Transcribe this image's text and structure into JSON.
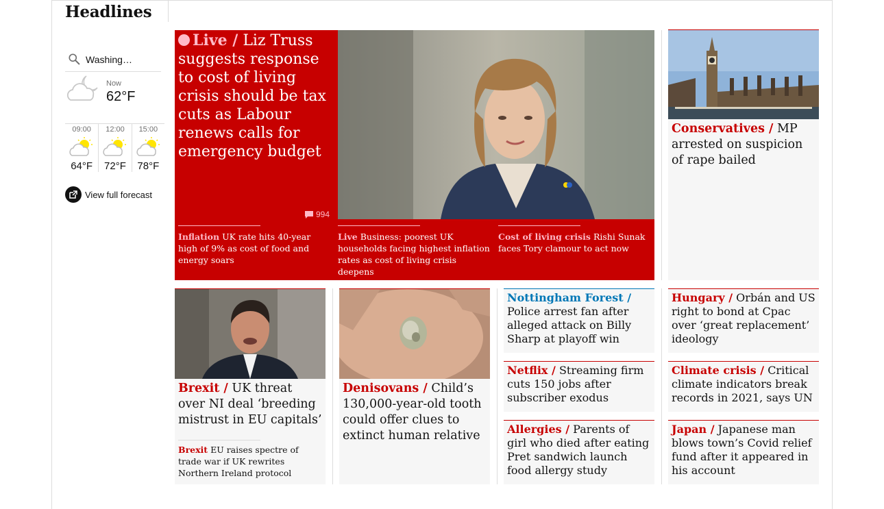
{
  "section_title": "Headlines",
  "weather": {
    "search_value": "Washing…",
    "now_label": "Now",
    "now_temp": "62°F",
    "forecast": [
      {
        "time": "09:00",
        "temp": "64°F",
        "icon": "partly-sunny-icon"
      },
      {
        "time": "12:00",
        "temp": "72°F",
        "icon": "partly-sunny-icon"
      },
      {
        "time": "15:00",
        "temp": "78°F",
        "icon": "partly-sunny-icon"
      }
    ],
    "full_forecast_label": "View full forecast"
  },
  "hero": {
    "kicker": "Live /",
    "headline": "Liz Truss suggests response to cost of living crisis should be tax cuts as Labour renews calls for emergency budget",
    "comments": "994",
    "sublinks": [
      {
        "kicker": "Inflation",
        "text": "UK rate hits 40-year high of 9% as cost of food and energy soars"
      },
      {
        "kicker": "Live",
        "text": "Business: poorest UK households facing highest inflation rates as cost of living crisis deepens"
      },
      {
        "kicker": "Cost of living crisis",
        "text": "Rishi Sunak faces Tory clamour to act now"
      }
    ]
  },
  "right_top": {
    "kicker": "Conservatives /",
    "headline": "MP arrested on suspicion of rape bailed"
  },
  "row2": {
    "brexit": {
      "kicker": "Brexit /",
      "headline": "UK threat over NI deal ‘breeding mistrust in EU capitals’",
      "sub_kicker": "Brexit",
      "sub_text": "EU raises spectre of trade war if UK rewrites Northern Ireland protocol"
    },
    "denisovans": {
      "kicker": "Denisovans /",
      "headline": "Child’s 130,000-year-old tooth could offer clues to extinct human relative"
    },
    "col3": [
      {
        "kicker": "Nottingham Forest /",
        "headline": "Police arrest fan after alleged attack on Billy Sharp at playoff win"
      },
      {
        "kicker": "Netflix /",
        "headline": "Streaming firm cuts 150 jobs after subscriber exodus"
      },
      {
        "kicker": "Allergies /",
        "headline": "Parents of girl who died after eating Pret sandwich launch food allergy study"
      }
    ],
    "col4": [
      {
        "kicker": "Hungary /",
        "headline": "Orbán and US right to bond at Cpac over ‘great replacement’ ideology"
      },
      {
        "kicker": "Climate crisis /",
        "headline": "Critical climate indicators break records in 2021, says UN"
      },
      {
        "kicker": "Japan /",
        "headline": "Japanese man blows town’s Covid relief fund after it appeared in his account"
      }
    ]
  },
  "colors": {
    "news_red": "#c70000",
    "sport_blue": "#0077b6",
    "live_pink": "#ffbac8"
  }
}
